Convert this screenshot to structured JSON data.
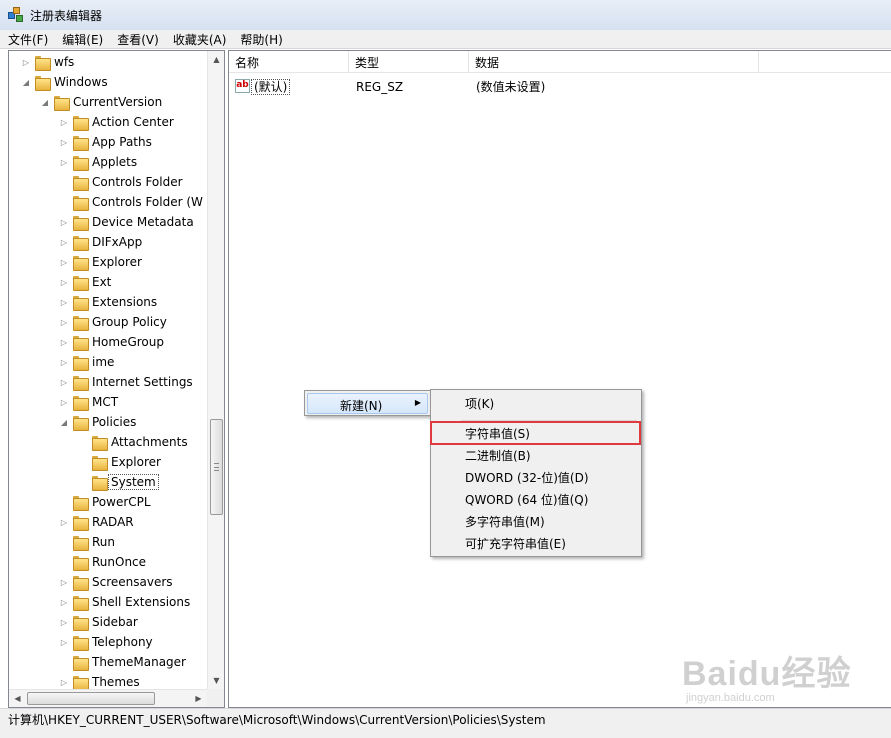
{
  "window": {
    "title": "注册表编辑器"
  },
  "menu": [
    "文件(F)",
    "编辑(E)",
    "查看(V)",
    "收藏夹(A)",
    "帮助(H)"
  ],
  "tree": {
    "items": [
      {
        "label": "wfs",
        "level": 0,
        "expander": "collapsed"
      },
      {
        "label": "Windows",
        "level": 0,
        "expander": "expanded"
      },
      {
        "label": "CurrentVersion",
        "level": 1,
        "expander": "expanded"
      },
      {
        "label": "Action Center",
        "level": 2,
        "expander": "collapsed"
      },
      {
        "label": "App Paths",
        "level": 2,
        "expander": "collapsed"
      },
      {
        "label": "Applets",
        "level": 2,
        "expander": "collapsed"
      },
      {
        "label": "Controls Folder",
        "level": 2,
        "expander": "none"
      },
      {
        "label": "Controls Folder (W",
        "level": 2,
        "expander": "none"
      },
      {
        "label": "Device Metadata",
        "level": 2,
        "expander": "collapsed"
      },
      {
        "label": "DIFxApp",
        "level": 2,
        "expander": "collapsed"
      },
      {
        "label": "Explorer",
        "level": 2,
        "expander": "collapsed"
      },
      {
        "label": "Ext",
        "level": 2,
        "expander": "collapsed"
      },
      {
        "label": "Extensions",
        "level": 2,
        "expander": "collapsed"
      },
      {
        "label": "Group Policy",
        "level": 2,
        "expander": "collapsed"
      },
      {
        "label": "HomeGroup",
        "level": 2,
        "expander": "collapsed"
      },
      {
        "label": "ime",
        "level": 2,
        "expander": "collapsed"
      },
      {
        "label": "Internet Settings",
        "level": 2,
        "expander": "collapsed"
      },
      {
        "label": "MCT",
        "level": 2,
        "expander": "collapsed"
      },
      {
        "label": "Policies",
        "level": 2,
        "expander": "expanded"
      },
      {
        "label": "Attachments",
        "level": 3,
        "expander": "none"
      },
      {
        "label": "Explorer",
        "level": 3,
        "expander": "none"
      },
      {
        "label": "System",
        "level": 3,
        "expander": "none",
        "selected": true
      },
      {
        "label": "PowerCPL",
        "level": 2,
        "expander": "none"
      },
      {
        "label": "RADAR",
        "level": 2,
        "expander": "collapsed"
      },
      {
        "label": "Run",
        "level": 2,
        "expander": "none"
      },
      {
        "label": "RunOnce",
        "level": 2,
        "expander": "none"
      },
      {
        "label": "Screensavers",
        "level": 2,
        "expander": "collapsed"
      },
      {
        "label": "Shell Extensions",
        "level": 2,
        "expander": "collapsed"
      },
      {
        "label": "Sidebar",
        "level": 2,
        "expander": "collapsed"
      },
      {
        "label": "Telephony",
        "level": 2,
        "expander": "collapsed"
      },
      {
        "label": "ThemeManager",
        "level": 2,
        "expander": "none"
      },
      {
        "label": "Themes",
        "level": 2,
        "expander": "collapsed"
      }
    ]
  },
  "list": {
    "columns": [
      "名称",
      "类型",
      "数据"
    ],
    "rows": [
      {
        "icon": "string-value-icon",
        "icon_text": "ab",
        "name": "(默认)",
        "type": "REG_SZ",
        "data": "(数值未设置)"
      }
    ]
  },
  "context_menu": {
    "new_label": "新建(N)",
    "submenu": [
      "项(K)",
      "字符串值(S)",
      "二进制值(B)",
      "DWORD (32-位)值(D)",
      "QWORD (64 位)值(Q)",
      "多字符串值(M)",
      "可扩充字符串值(E)"
    ],
    "highlighted": "字符串值(S)"
  },
  "status": {
    "path": "计算机\\HKEY_CURRENT_USER\\Software\\Microsoft\\Windows\\CurrentVersion\\Policies\\System"
  },
  "watermark": {
    "text": "Baidu经验",
    "sub": "jingyan.baidu.com"
  },
  "colors": {
    "highlight_border": "#e0393e",
    "menu_hover": "#d6e7fb"
  }
}
